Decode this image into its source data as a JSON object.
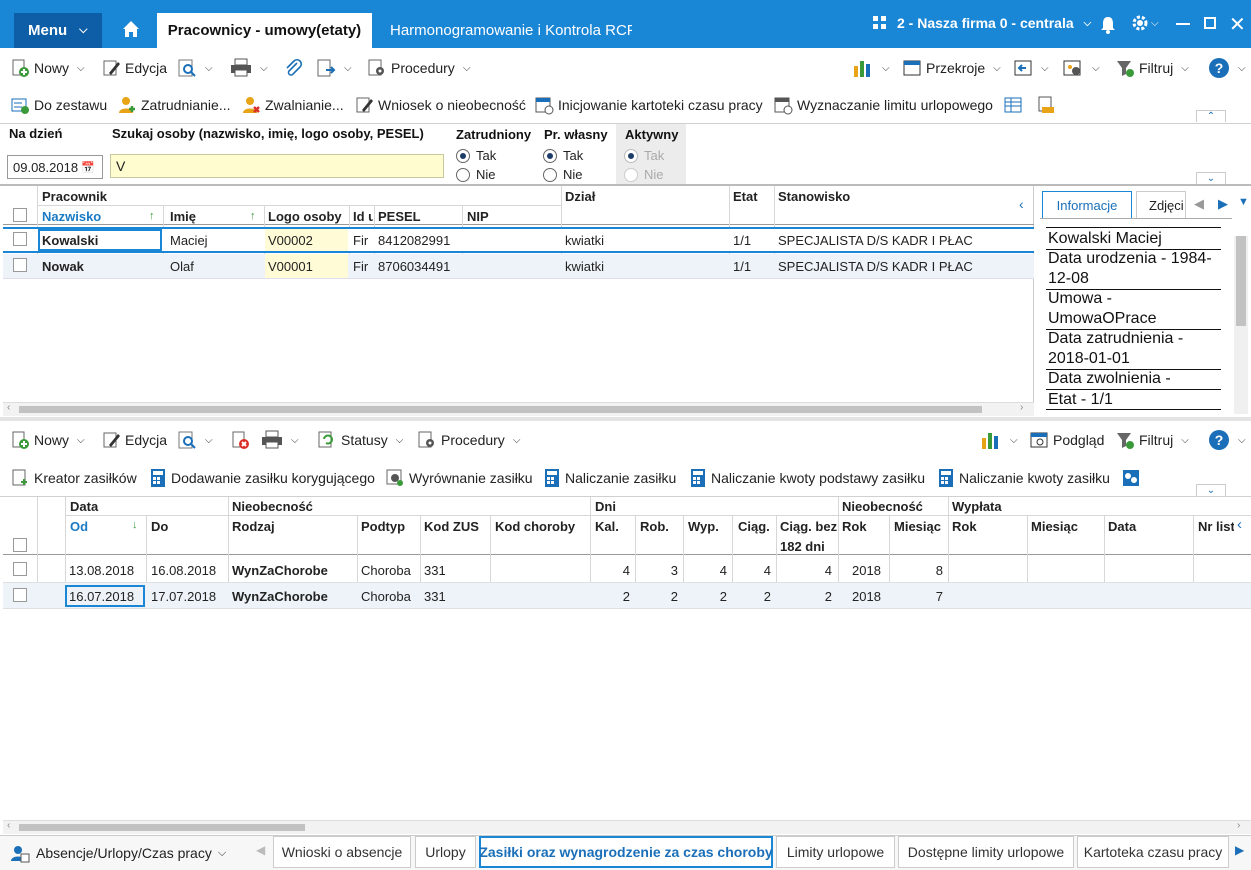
{
  "titlebar": {
    "menu_label": "Menu",
    "active_tab": "Pracownicy - umowy(etaty)",
    "second_tab": "Harmonogramowanie i Kontrola RCP",
    "company": "2 - Nasza firma 0 - centrala",
    "colors": {
      "bar": "#1a86d6",
      "menu": "#0d5ea6"
    }
  },
  "toolbar1": {
    "new": "Nowy",
    "edit": "Edycja",
    "procedures": "Procedury",
    "sections": "Przekroje",
    "filter": "Filtruj"
  },
  "toolbar2": {
    "add_set": "Do zestawu",
    "hire": "Zatrudnianie...",
    "fire": "Zwalnianie...",
    "absence_request": "Wniosek o nieobecność",
    "init_card": "Inicjowanie kartoteki czasu pracy",
    "leave_limit": "Wyznaczanie limitu urlopowego"
  },
  "filters": {
    "date_label": "Na dzień",
    "date_value": "09.08.2018",
    "search_label": "Szukaj osoby (nazwisko, imię, logo osoby, PESEL)",
    "search_value": "V",
    "employed_label": "Zatrudniony",
    "own_label": "Pr. własny",
    "active_label": "Aktywny",
    "yes": "Tak",
    "no": "Nie"
  },
  "employees_grid": {
    "group_header": "Pracownik",
    "columns": {
      "surname": "Nazwisko",
      "name": "Imię",
      "logo": "Logo osoby",
      "id": "Id u",
      "pesel": "PESEL",
      "nip": "NIP",
      "dept": "Dział",
      "etat": "Etat",
      "position": "Stanowisko"
    },
    "rows": [
      {
        "surname": "Kowalski",
        "name": "Maciej",
        "logo": "V00002",
        "id": "Fir",
        "pesel": "8412082991",
        "nip": "",
        "dept": "kwiatki",
        "etat": "1/1",
        "position": "SPECJALISTA D/S KADR I PŁAC"
      },
      {
        "surname": "Nowak",
        "name": "Olaf",
        "logo": "V00001",
        "id": "Fir",
        "pesel": "8706034491",
        "nip": "",
        "dept": "kwiatki",
        "etat": "1/1",
        "position": "SPECJALISTA D/S KADR I PŁAC"
      }
    ]
  },
  "info_panel": {
    "tab_info": "Informacje",
    "tab_photo": "Zdjęci",
    "lines": [
      "Kowalski Maciej",
      "Data urodzenia - 1984-",
      "12-08",
      "Umowa -",
      "UmowaOPrace",
      "Data zatrudnienia -",
      "2018-01-01",
      "Data zwolnienia -",
      "Etat - 1/1"
    ]
  },
  "toolbar3": {
    "new": "Nowy",
    "edit": "Edycja",
    "status": "Statusy",
    "procedures": "Procedury",
    "preview": "Podgląd",
    "filter": "Filtruj"
  },
  "toolbar4": {
    "wizard": "Kreator zasiłków",
    "correction": "Dodawanie zasiłku korygującego",
    "equalize": "Wyrównanie zasiłku",
    "calc": "Naliczanie zasiłku",
    "calc_base": "Naliczanie kwoty podstawy zasiłku",
    "calc_amount": "Naliczanie kwoty zasiłku"
  },
  "benefits_grid": {
    "groups": {
      "date": "Data",
      "absence": "Nieobecność",
      "days": "Dni",
      "absence2": "Nieobecność",
      "payout": "Wypłata"
    },
    "columns": {
      "from": "Od",
      "to": "Do",
      "type": "Rodzaj",
      "subtype": "Podtyp",
      "zus": "Kod ZUS",
      "disease": "Kod choroby",
      "cal": "Kal.",
      "work": "Rob.",
      "wyp": "Wyp.",
      "cont": "Ciąg.",
      "cont182a": "Ciąg. bez",
      "cont182b": "182 dni",
      "year": "Rok",
      "month": "Miesiąc",
      "pyear": "Rok",
      "pmonth": "Miesiąc",
      "pdate": "Data",
      "list": "Nr list"
    },
    "rows": [
      {
        "from": "13.08.2018",
        "to": "16.08.2018",
        "type": "WynZaChorobe",
        "subtype": "Choroba",
        "zus": "331",
        "disease": "",
        "cal": "4",
        "work": "3",
        "wyp": "4",
        "cont": "4",
        "cont182": "4",
        "year": "2018",
        "month": "8"
      },
      {
        "from": "16.07.2018",
        "to": "17.07.2018",
        "type": "WynZaChorobe",
        "subtype": "Choroba",
        "zus": "331",
        "disease": "",
        "cal": "2",
        "work": "2",
        "wyp": "2",
        "cont": "2",
        "cont182": "2",
        "year": "2018",
        "month": "7"
      }
    ]
  },
  "bottom": {
    "section": "Absencje/Urlopy/Czas pracy",
    "tabs": [
      "Wnioski o absencje",
      "Urlopy",
      "Zasiłki oraz wynagrodzenie za czas choroby",
      "Limity urlopowe",
      "Dostępne limity urlopowe",
      "Kartoteka czasu pracy"
    ]
  }
}
